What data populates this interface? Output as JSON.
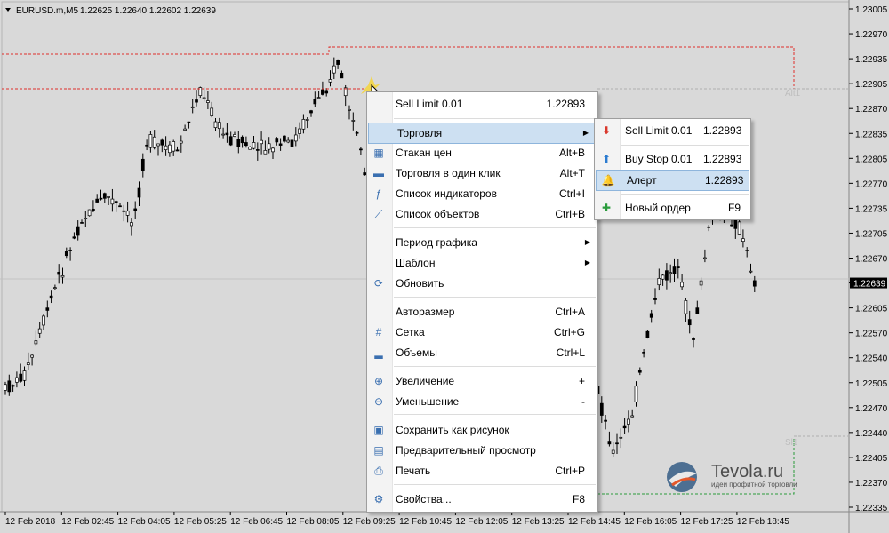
{
  "header": {
    "symbol": "EURUSD.m,M5",
    "ohlc": "1.22625 1.22640 1.22602 1.22639"
  },
  "price_axis": {
    "labels": [
      "1.23005",
      "1.22970",
      "1.22935",
      "1.22905",
      "1.22870",
      "1.22835",
      "1.22805",
      "1.22770",
      "1.22735",
      "1.22705",
      "1.22670",
      "1.22639",
      "1.22605",
      "1.22570",
      "1.22540",
      "1.22505",
      "1.22470",
      "1.22440",
      "1.22405",
      "1.22370",
      "1.22335"
    ],
    "current_price": "1.22639"
  },
  "time_axis": {
    "labels": [
      "12 Feb 2018",
      "12 Feb 02:45",
      "12 Feb 04:05",
      "12 Feb 05:25",
      "12 Feb 06:45",
      "12 Feb 08:05",
      "12 Feb 09:25",
      "12 Feb 10:45",
      "12 Feb 12:05",
      "12 Feb 13:25",
      "12 Feb 14:45",
      "12 Feb 16:05",
      "12 Feb 17:25",
      "12 Feb 18:45"
    ]
  },
  "order_lines": {
    "alert_label": "Alt1",
    "sell_label": "Sl1"
  },
  "logo": {
    "name": "Tevola.ru",
    "tagline": "идеи профитной торговли"
  },
  "context_menu": {
    "items": [
      {
        "label": "Sell Limit 0.01",
        "shortcut": "1.22893",
        "icon": "sell-limit-icon",
        "glyph": ""
      },
      {
        "label": "Торговля",
        "shortcut": "",
        "icon": "trade-icon",
        "glyph": "",
        "submenu": true,
        "highlighted": true
      },
      {
        "label": "Стакан цен",
        "shortcut": "Alt+B",
        "icon": "depth-of-market-icon",
        "glyph": "▦"
      },
      {
        "label": "Торговля в один клик",
        "shortcut": "Alt+T",
        "icon": "one-click-trading-icon",
        "glyph": "▬"
      },
      {
        "label": "Список индикаторов",
        "shortcut": "Ctrl+I",
        "icon": "indicators-list-icon",
        "glyph": "ƒ"
      },
      {
        "label": "Список объектов",
        "shortcut": "Ctrl+B",
        "icon": "objects-list-icon",
        "glyph": "⟋"
      },
      {
        "label": "Период графика",
        "shortcut": "",
        "icon": "",
        "glyph": "",
        "submenu": true
      },
      {
        "label": "Шаблон",
        "shortcut": "",
        "icon": "",
        "glyph": "",
        "submenu": true
      },
      {
        "label": "Обновить",
        "shortcut": "",
        "icon": "refresh-icon",
        "glyph": "⟳"
      },
      {
        "label": "Авторазмер",
        "shortcut": "Ctrl+A",
        "icon": "",
        "glyph": ""
      },
      {
        "label": "Сетка",
        "shortcut": "Ctrl+G",
        "icon": "grid-icon",
        "glyph": "#"
      },
      {
        "label": "Объемы",
        "shortcut": "Ctrl+L",
        "icon": "volumes-icon",
        "glyph": "▂"
      },
      {
        "label": "Увеличение",
        "shortcut": "+",
        "icon": "zoom-in-icon",
        "glyph": "⊕"
      },
      {
        "label": "Уменьшение",
        "shortcut": "-",
        "icon": "zoom-out-icon",
        "glyph": "⊖"
      },
      {
        "label": "Сохранить как рисунок",
        "shortcut": "",
        "icon": "save-picture-icon",
        "glyph": "▣"
      },
      {
        "label": "Предварительный просмотр",
        "shortcut": "",
        "icon": "print-preview-icon",
        "glyph": "▤"
      },
      {
        "label": "Печать",
        "shortcut": "Ctrl+P",
        "icon": "print-icon",
        "glyph": "⎙"
      },
      {
        "label": "Свойства...",
        "shortcut": "F8",
        "icon": "properties-icon",
        "glyph": "⚙"
      }
    ]
  },
  "trade_submenu": {
    "items": [
      {
        "label": "Sell Limit 0.01",
        "price": "1.22893",
        "icon": "sell-arrow-icon",
        "glyph": "⬇",
        "color": "#d9382c"
      },
      {
        "label": "Buy Stop 0.01",
        "price": "1.22893",
        "icon": "buy-arrow-icon",
        "glyph": "⬆",
        "color": "#2b7bd0"
      },
      {
        "label": "Алерт",
        "price": "1.22893",
        "icon": "alert-bell-icon",
        "glyph": "🔔",
        "color": "#d9b12c",
        "highlighted": true
      },
      {
        "label": "Новый ордер",
        "price": "F9",
        "icon": "new-order-icon",
        "glyph": "✚",
        "color": "#2a9c3c"
      }
    ]
  },
  "colors": {
    "background": "#d9d9d9",
    "grid": "#c4c4c4",
    "candle": "#000000",
    "alert_line": "#e0302a",
    "sell_line": "#2a9c3c",
    "highlight": "#cde0f2"
  }
}
